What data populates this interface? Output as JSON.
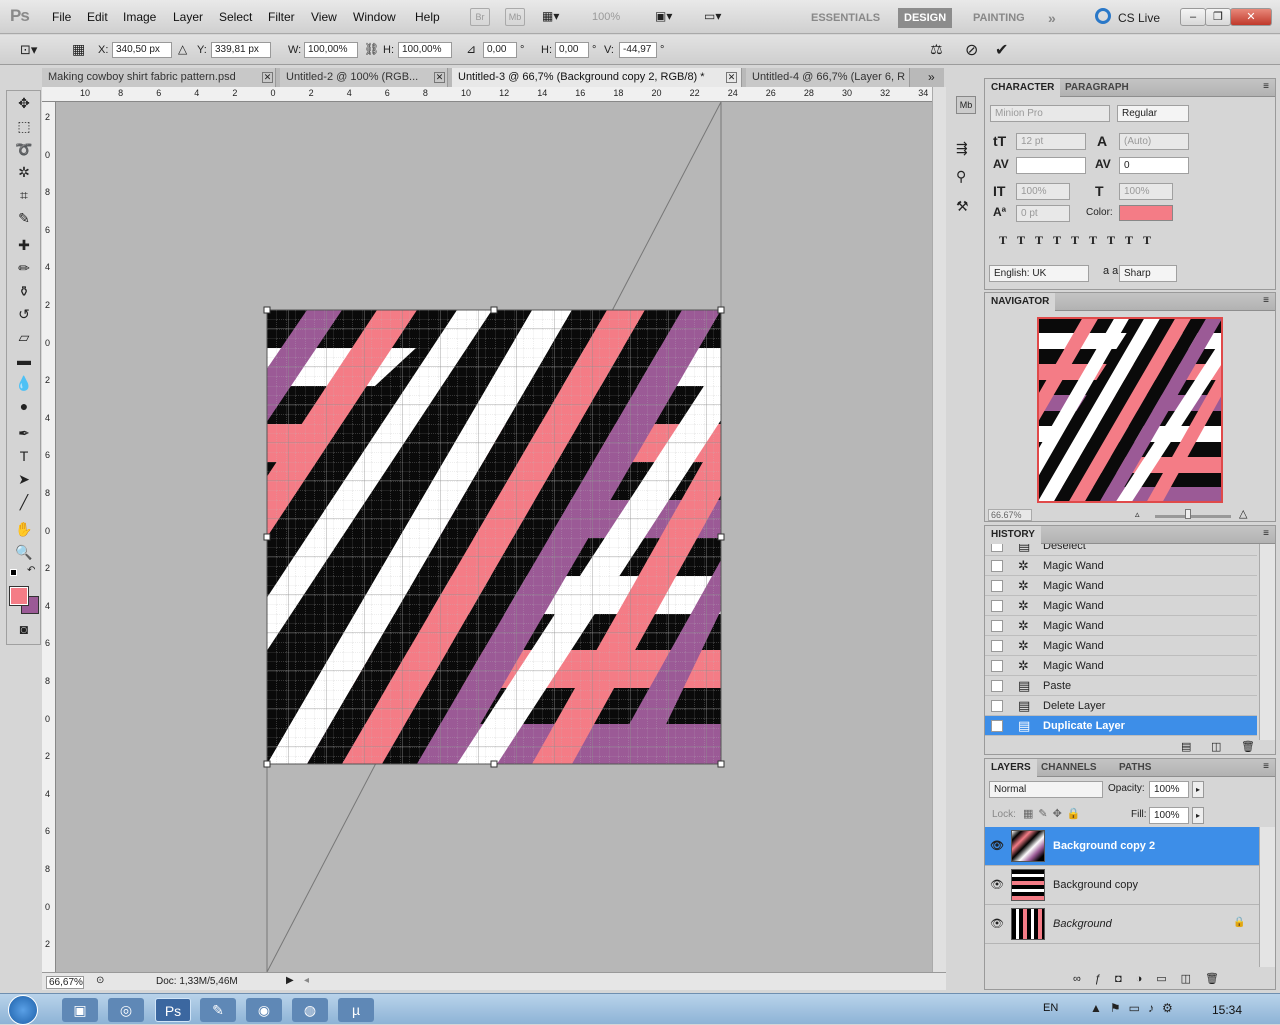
{
  "app": {
    "logo": "Ps"
  },
  "menu": [
    "File",
    "Edit",
    "Image",
    "Layer",
    "Select",
    "Filter",
    "View",
    "Window",
    "Help"
  ],
  "top_controls": {
    "br": "Br",
    "mb": "Mb",
    "zoom": "100%"
  },
  "workspaces": {
    "essentials": "ESSENTIALS",
    "design": "DESIGN",
    "painting": "PAINTING",
    "more": "»",
    "cslive": "CS Live"
  },
  "options": {
    "x_label": "X:",
    "x_value": "340,50 px",
    "y_label": "Y:",
    "y_value": "339,81 px",
    "w_label": "W:",
    "w_value": "100,00%",
    "h_label": "H:",
    "h_value": "100,00%",
    "angle_value": "0,00",
    "angle_unit": "°",
    "hskew_label": "H:",
    "hskew_value": "0,00",
    "hskew_unit": "°",
    "vskew_label": "V:",
    "vskew_value": "-44,97",
    "vskew_unit": "°"
  },
  "tabs": [
    {
      "label": "Making cowboy shirt fabric pattern.psd"
    },
    {
      "label": "Untitled-2 @ 100% (RGB..."
    },
    {
      "label": "Untitled-3 @ 66,7% (Background copy 2, RGB/8) *"
    },
    {
      "label": "Untitled-4 @ 66,7% (Layer 6, R"
    }
  ],
  "hruler_labels": [
    "10",
    "8",
    "6",
    "4",
    "2",
    "0",
    "2",
    "4",
    "6",
    "8",
    "10",
    "12",
    "14",
    "16",
    "18",
    "20",
    "22",
    "24",
    "26",
    "28",
    "30",
    "32",
    "34"
  ],
  "vruler_labels": [
    "2",
    "0",
    "8",
    "6",
    "4",
    "2",
    "0",
    "2",
    "4",
    "6",
    "8",
    "0",
    "2",
    "4",
    "6",
    "8",
    "0",
    "2",
    "4",
    "6",
    "8",
    "0",
    "2",
    "4"
  ],
  "status": {
    "zoom": "66,67%",
    "doc": "Doc: 1,33M/5,46M"
  },
  "character_panel": {
    "tab_character": "CHARACTER",
    "tab_paragraph": "PARAGRAPH",
    "font_family": "Minion Pro",
    "font_style": "Regular",
    "size": "12 pt",
    "leading": "(Auto)",
    "kerning": "",
    "tracking": "0",
    "vscale": "100%",
    "hscale": "100%",
    "baseline": "0 pt",
    "color_label": "Color:",
    "color_swatch": "#f47c86",
    "language": "English: UK",
    "aa_label": "a a",
    "antialias": "Sharp"
  },
  "navigator": {
    "title": "NAVIGATOR",
    "zoom": "66.67%"
  },
  "history": {
    "title": "HISTORY",
    "items": [
      {
        "label": "Deselect",
        "icon": "document-icon"
      },
      {
        "label": "Magic Wand",
        "icon": "magic-wand-icon"
      },
      {
        "label": "Magic Wand",
        "icon": "magic-wand-icon"
      },
      {
        "label": "Magic Wand",
        "icon": "magic-wand-icon"
      },
      {
        "label": "Magic Wand",
        "icon": "magic-wand-icon"
      },
      {
        "label": "Magic Wand",
        "icon": "magic-wand-icon"
      },
      {
        "label": "Magic Wand",
        "icon": "magic-wand-icon"
      },
      {
        "label": "Paste",
        "icon": "document-icon"
      },
      {
        "label": "Delete Layer",
        "icon": "document-icon"
      },
      {
        "label": "Duplicate Layer",
        "icon": "document-icon",
        "selected": true
      }
    ]
  },
  "layers": {
    "tab_layers": "LAYERS",
    "tab_channels": "CHANNELS",
    "tab_paths": "PATHS",
    "blend_mode": "Normal",
    "opacity_label": "Opacity:",
    "opacity": "100%",
    "lock_label": "Lock:",
    "fill_label": "Fill:",
    "fill": "100%",
    "items": [
      {
        "name": "Background copy 2",
        "selected": true
      },
      {
        "name": "Background copy"
      },
      {
        "name": "Background",
        "locked": true
      }
    ]
  },
  "taskbar": {
    "lang": "EN",
    "time": "15:34"
  },
  "colors": {
    "pink": "#f47c86",
    "purple": "#9b5a96",
    "black": "#0a0a0a",
    "white": "#ffffff",
    "highlight": "#3d8ee8"
  }
}
